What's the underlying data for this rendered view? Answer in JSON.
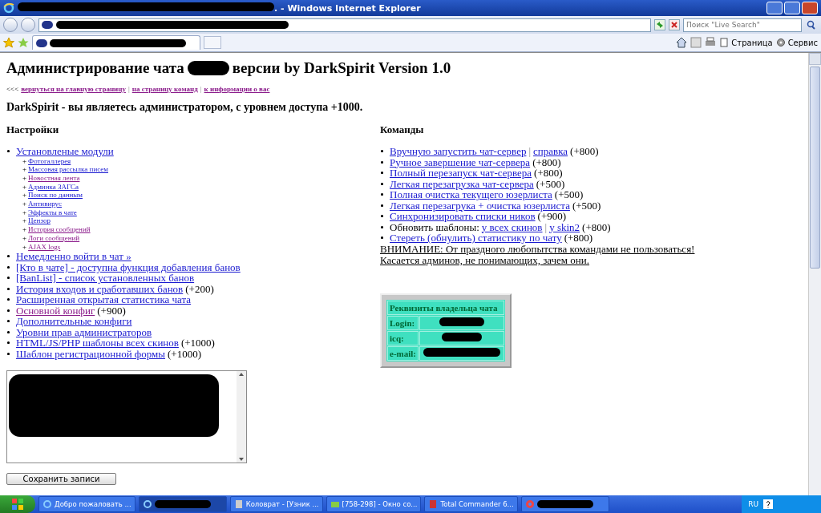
{
  "window": {
    "title": ". - Windows Internet Explorer"
  },
  "search": {
    "placeholder": "Поиск \"Live Search\""
  },
  "command_bar": [
    {
      "label": "Страница"
    },
    {
      "label": "Сервис"
    }
  ],
  "page": {
    "heading": {
      "before": "Администрирование чата",
      "after": "версии by DarkSpirit Version 1.0"
    },
    "nav": [
      {
        "kind": "text",
        "text": "<<<"
      },
      {
        "kind": "link",
        "text": "вернуться на главную страницу",
        "visited": true
      },
      {
        "kind": "sep",
        "text": "|"
      },
      {
        "kind": "link",
        "text": "на страницу команд",
        "visited": true
      },
      {
        "kind": "sep",
        "text": "|"
      },
      {
        "kind": "link",
        "text": "к информации о вас",
        "visited": true
      }
    ],
    "welcome": "DarkSpirit - вы являетесь администратором, с уровнем доступа +1000.",
    "settings": {
      "title": "Настройки",
      "items": [
        {
          "parts": [
            {
              "kind": "link",
              "text": "Установленые модули",
              "visited": false
            }
          ],
          "children": [
            {
              "bullet": "+",
              "text": "Фотогаллерея",
              "visited": false
            },
            {
              "bullet": "+",
              "text": "Массовая рассылка писем",
              "visited": false
            },
            {
              "bullet": "+",
              "text": "Новостная лента",
              "visited": true
            },
            {
              "bullet": "+",
              "text": "Админка ЗАГСа",
              "visited": false
            },
            {
              "bullet": "+",
              "text": "Поиск по данным",
              "visited": false
            },
            {
              "bullet": "+",
              "text": "Антивирус",
              "visited": false
            },
            {
              "bullet": "+",
              "text": "Эффекты в чате",
              "visited": false
            },
            {
              "bullet": "+",
              "text": "Цензор",
              "visited": false
            },
            {
              "bullet": "+",
              "text": "История сообщений",
              "visited": true
            },
            {
              "bullet": "+",
              "text": "Логи сообщений",
              "visited": true
            },
            {
              "bullet": "+",
              "text": "AJAX logs",
              "visited": true
            }
          ]
        },
        {
          "parts": [
            {
              "kind": "link",
              "text": "Немедленно войти в чат »",
              "visited": false
            }
          ]
        },
        {
          "parts": [
            {
              "kind": "link",
              "text": "[Кто в чате] - доступна функция добавления банов",
              "visited": false
            }
          ]
        },
        {
          "parts": [
            {
              "kind": "link",
              "text": "[BanList] - список установленных банов",
              "visited": false
            }
          ]
        },
        {
          "parts": [
            {
              "kind": "link",
              "text": "История входов и сработавших банов",
              "visited": false
            },
            {
              "kind": "text",
              "text": "(+200)"
            }
          ]
        },
        {
          "parts": [
            {
              "kind": "link",
              "text": "Расширенная открытая статистика чата",
              "visited": false
            }
          ]
        },
        {
          "parts": [
            {
              "kind": "link",
              "text": "Основной конфиг",
              "visited": true
            },
            {
              "kind": "text",
              "text": "(+900)"
            }
          ]
        },
        {
          "parts": [
            {
              "kind": "link",
              "text": "Дополнительные конфиги",
              "visited": false
            }
          ]
        },
        {
          "parts": [
            {
              "kind": "link",
              "text": "Уровни прав администраторов",
              "visited": false
            }
          ]
        },
        {
          "parts": [
            {
              "kind": "link",
              "text": "HTML/JS/PHP шаблоны всех скинов",
              "visited": false
            },
            {
              "kind": "text",
              "text": "(+1000)"
            }
          ]
        },
        {
          "parts": [
            {
              "kind": "link",
              "text": "Шаблон регистрационной формы",
              "visited": false
            },
            {
              "kind": "text",
              "text": "(+1000)"
            }
          ]
        }
      ]
    },
    "commands": {
      "title": "Команды",
      "items": [
        {
          "parts": [
            {
              "kind": "link",
              "text": "Вручную запустить чат-сервер",
              "visited": false
            },
            {
              "kind": "sep",
              "text": "|"
            },
            {
              "kind": "link",
              "text": "справка",
              "visited": false
            },
            {
              "kind": "text",
              "text": "(+800)"
            }
          ]
        },
        {
          "parts": [
            {
              "kind": "link",
              "text": "Ручное завершение чат-сервера",
              "visited": false
            },
            {
              "kind": "text",
              "text": "(+800)"
            }
          ]
        },
        {
          "parts": [
            {
              "kind": "link",
              "text": "Полный перезапуск чат-сервера",
              "visited": false
            },
            {
              "kind": "text",
              "text": "(+800)"
            }
          ]
        },
        {
          "parts": [
            {
              "kind": "link",
              "text": "Легкая перезагрузка чат-сервера",
              "visited": false
            },
            {
              "kind": "text",
              "text": "(+500)"
            }
          ]
        },
        {
          "parts": [
            {
              "kind": "link",
              "text": "Полная очистка текущего юзерлиста",
              "visited": false
            },
            {
              "kind": "text",
              "text": "(+500)"
            }
          ]
        },
        {
          "parts": [
            {
              "kind": "link",
              "text": "Легкая перезагрука + очистка юзерлиста",
              "visited": false
            },
            {
              "kind": "text",
              "text": "(+500)"
            }
          ]
        },
        {
          "parts": [
            {
              "kind": "link",
              "text": "Синхронизировать списки ников",
              "visited": false
            },
            {
              "kind": "text",
              "text": "(+900)"
            }
          ]
        },
        {
          "parts": [
            {
              "kind": "text",
              "text": "Обновить шаблоны:"
            },
            {
              "kind": "link",
              "text": "у всех скинов",
              "visited": false
            },
            {
              "kind": "sep",
              "text": "|"
            },
            {
              "kind": "link",
              "text": "у skin2",
              "visited": false
            },
            {
              "kind": "text",
              "text": "(+800)"
            }
          ]
        },
        {
          "parts": [
            {
              "kind": "link",
              "text": "Стереть (обнулить) статистику по чату",
              "visited": false
            },
            {
              "kind": "text",
              "text": "(+800)"
            }
          ]
        }
      ],
      "warning": [
        "ВНИМАНИЕ: От праздного любопытства командами не пользоваться!",
        "Касается админов, не понимающих, зачем они."
      ]
    },
    "owner_table": {
      "title": "Реквизиты владельца чата",
      "rows": [
        {
          "label": "Login:"
        },
        {
          "label": "icq:"
        },
        {
          "label": "e-mail:"
        }
      ]
    },
    "save_button": "Сохранить записи"
  },
  "taskbar": {
    "tasks": [
      {
        "kind": "app",
        "label": "Добро пожаловать ...",
        "active": false
      },
      {
        "kind": "redacted",
        "active": true
      },
      {
        "kind": "app",
        "label": "Коловрат - [Узник ...",
        "active": false
      },
      {
        "kind": "app",
        "label": "[758-298] - Окно со...",
        "active": false
      },
      {
        "kind": "app",
        "label": "Total Commander 6...",
        "active": false
      },
      {
        "kind": "redacted",
        "active": false
      }
    ],
    "language": "RU"
  }
}
